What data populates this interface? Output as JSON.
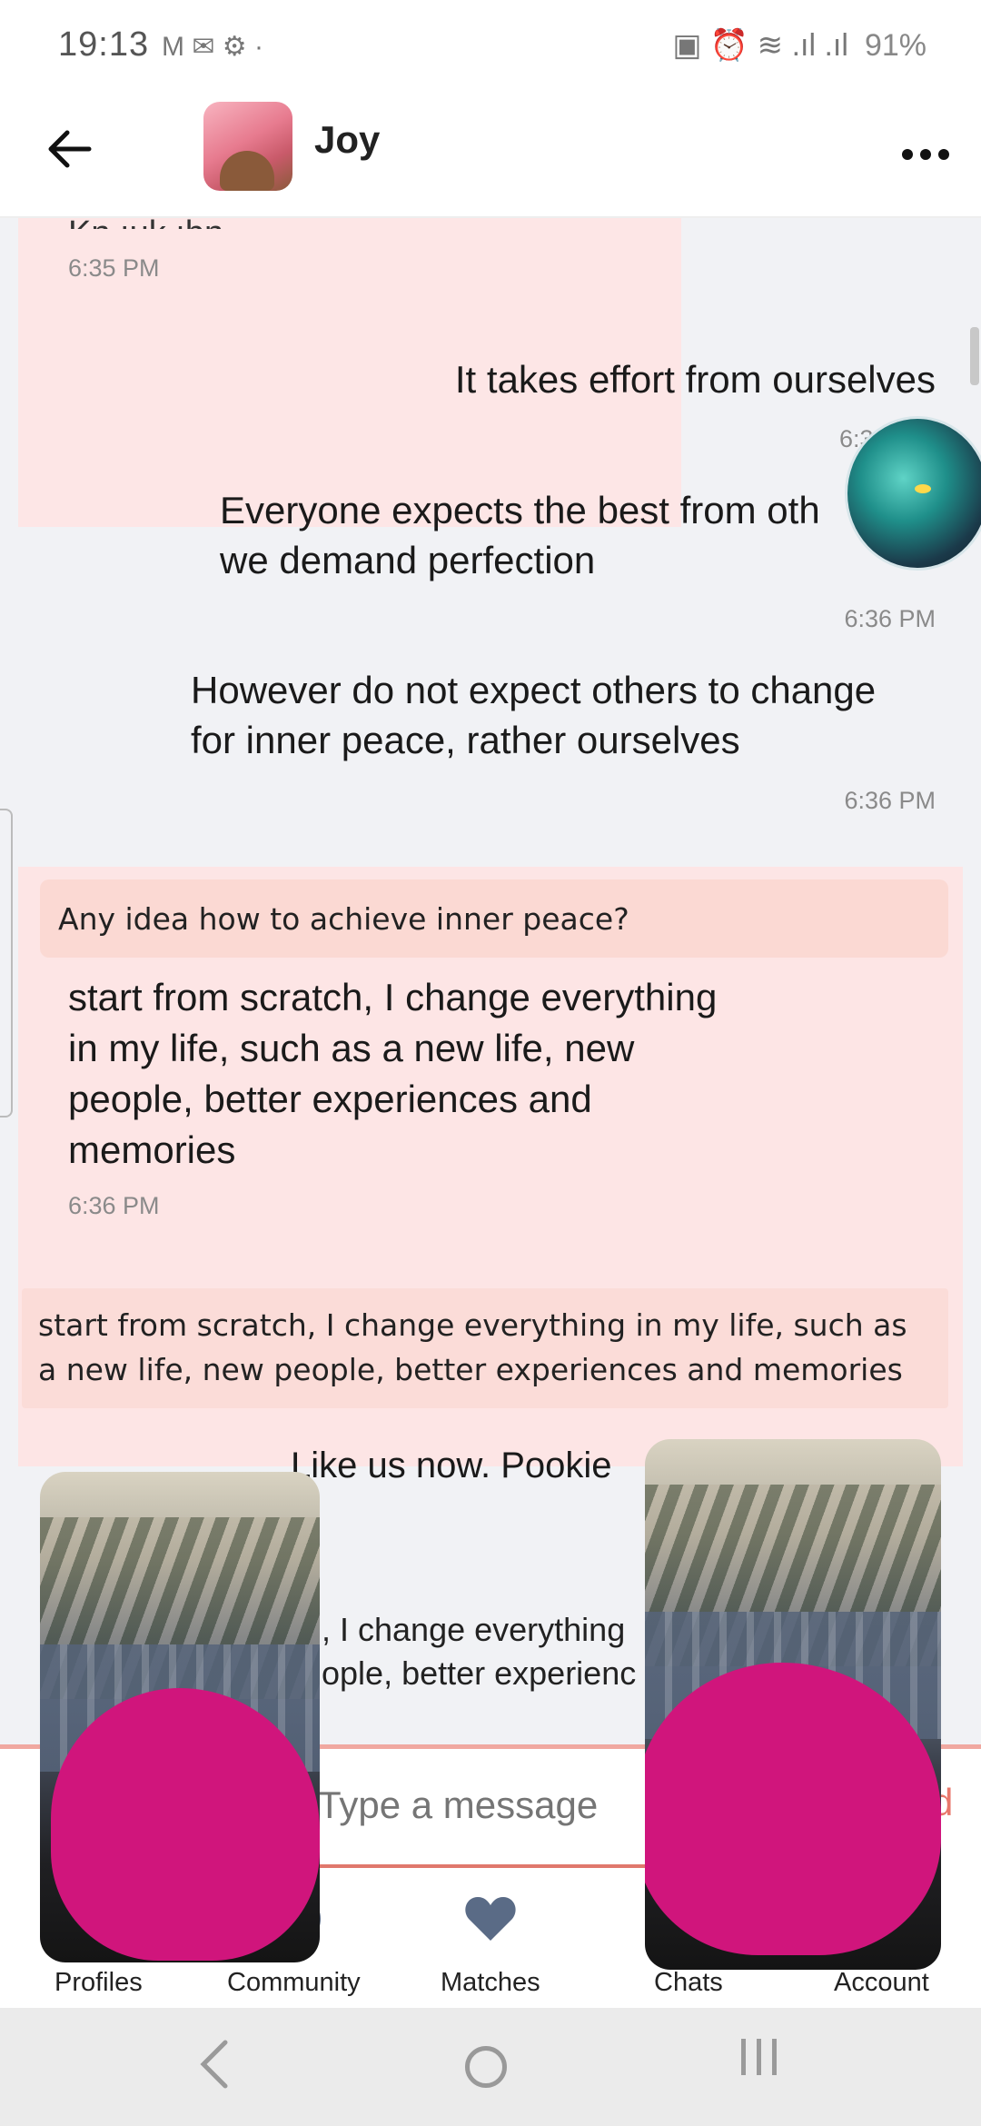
{
  "status_bar": {
    "time": "19:13",
    "left_icons": "M  ✉  ⚙  ·",
    "right_icons": "▣  ⏰  ≋ .ıl .ıl",
    "battery": "91%"
  },
  "header": {
    "contact_name": "Joy",
    "avatar_icon": "anime-avatar-icon",
    "back_icon": "arrow-left-icon",
    "more_icon": "ellipsis-icon"
  },
  "messages": {
    "m0_cut_text": "Kn ıuk ıbn",
    "m0_time": "6:35 PM",
    "m1_text": "It takes effort from ourselves",
    "m1_time": "6:3",
    "m2_text_line1": "Everyone expects the best from oth",
    "m2_text_line2": "we demand perfection",
    "m2_time": "6:36 PM",
    "m3_text_line1": "However do not expect others to change",
    "m3_text_line2": "for inner peace, rather ourselves",
    "m3_time": "6:36 PM",
    "m4_quote": "Any idea how to achieve inner peace?",
    "m4_text_line1": "start from scratch, I change everything",
    "m4_text_line2": "in my life, such as a new life, new",
    "m4_text_line3": "people, better experiences and",
    "m4_text_line4": "memories",
    "m4_time": "6:36 PM",
    "m5_quote_line1": "start from scratch, I change everything in my life, such as",
    "m5_quote_line2": "a new life, new people, better experiences and memories",
    "m5_text": "Like us now. Pookie",
    "m6_partial_line1": ", I change everything",
    "m6_partial_line2": "ople, better experienc"
  },
  "composer": {
    "placeholder": "Type a message",
    "send_label": "d"
  },
  "bottom_nav": [
    {
      "label": "Profiles",
      "icon": "profiles-icon"
    },
    {
      "label": "Community",
      "icon": "community-icon"
    },
    {
      "label": "Matches",
      "icon": "heart-icon"
    },
    {
      "label": "Chats",
      "icon": "chat-icon"
    },
    {
      "label": "Account",
      "icon": "account-icon"
    }
  ],
  "system_nav": {
    "back_icon": "back-chevron-icon",
    "home_icon": "home-circle-icon",
    "recents_icon": "recents-icon"
  },
  "colors": {
    "incoming_bubble": "#fde5e5",
    "quote_bubble": "#fbd9d3",
    "accent": "#e8776b",
    "redaction": "#d0157c",
    "nav_icon": "#5a6b86"
  }
}
